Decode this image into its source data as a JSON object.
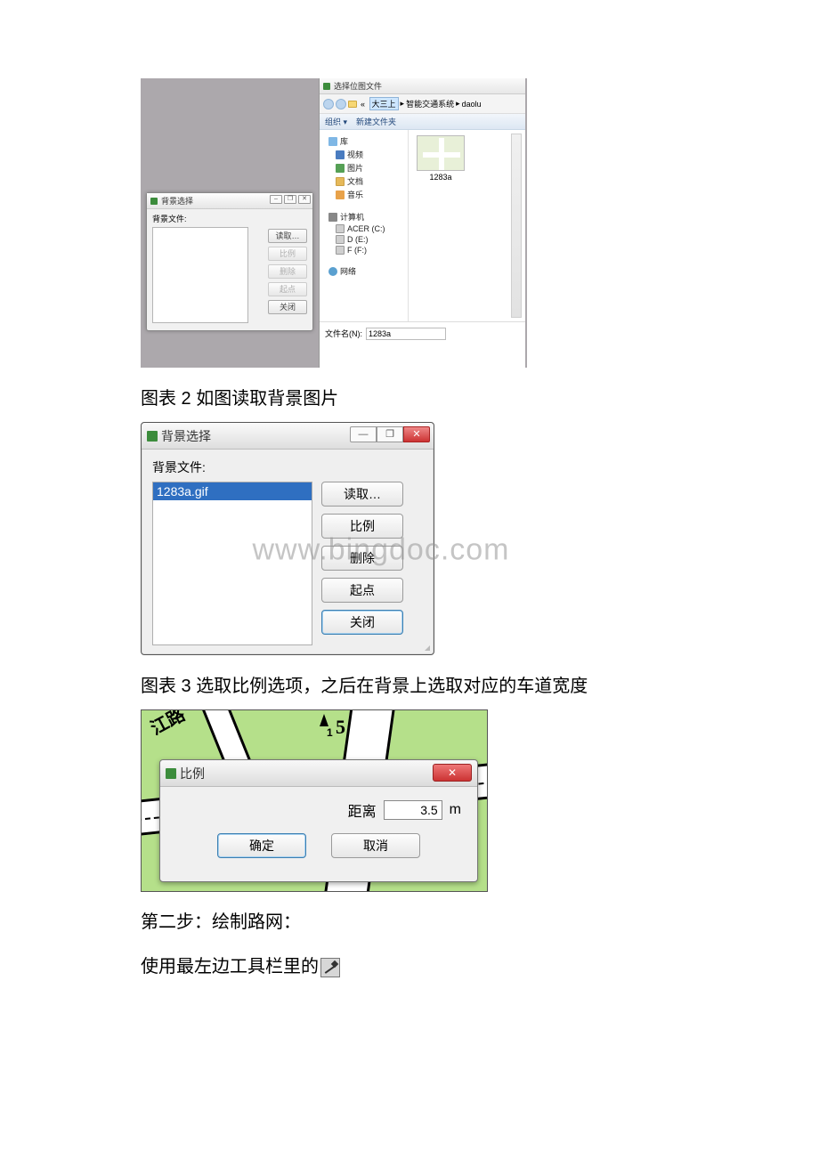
{
  "caption_fig2": "图表 2 如图读取背景图片",
  "caption_fig3": "图表 3 选取比例选项，之后在背景上选取对应的车道宽度",
  "step2_text": "第二步：绘制路网：",
  "step2_tool_text": "使用最左边工具栏里的",
  "dlg_small": {
    "title": "背景选择",
    "label": "背景文件:",
    "buttons": {
      "read": "读取…",
      "scale": "比例",
      "delete": "删除",
      "origin": "起点",
      "close": "关闭"
    }
  },
  "picker": {
    "title": "选择位图文件",
    "crumb_sel": "大三上",
    "crumb2": "智能交通系统",
    "crumb3": "daolu",
    "toolbar": {
      "org": "组织 ▾",
      "newfolder": "新建文件夹"
    },
    "tree": {
      "lib": "库",
      "video": "视频",
      "pic": "图片",
      "doc": "文档",
      "music": "音乐",
      "pc": "计算机",
      "cdrive": "ACER (C:)",
      "ddrive": "D (E:)",
      "fdrive": "F (F:)",
      "net": "网络"
    },
    "thumb_label": "1283a",
    "filename_label": "文件名(N):",
    "filename_value": "1283a"
  },
  "dlg_large": {
    "title": "背景选择",
    "label": "背景文件:",
    "selected": "1283a.gif",
    "buttons": {
      "read": "读取…",
      "scale": "比例",
      "delete": "删除",
      "origin": "起点",
      "close": "关闭"
    }
  },
  "watermark": "www.bingdoc.com",
  "map": {
    "road_label": "江路",
    "mark_5": "5",
    "mark_1": "1"
  },
  "dlg_scale": {
    "title": "比例",
    "distance_label": "距离",
    "distance_value": "3.5",
    "unit": "m",
    "ok": "确定",
    "cancel": "取消"
  }
}
